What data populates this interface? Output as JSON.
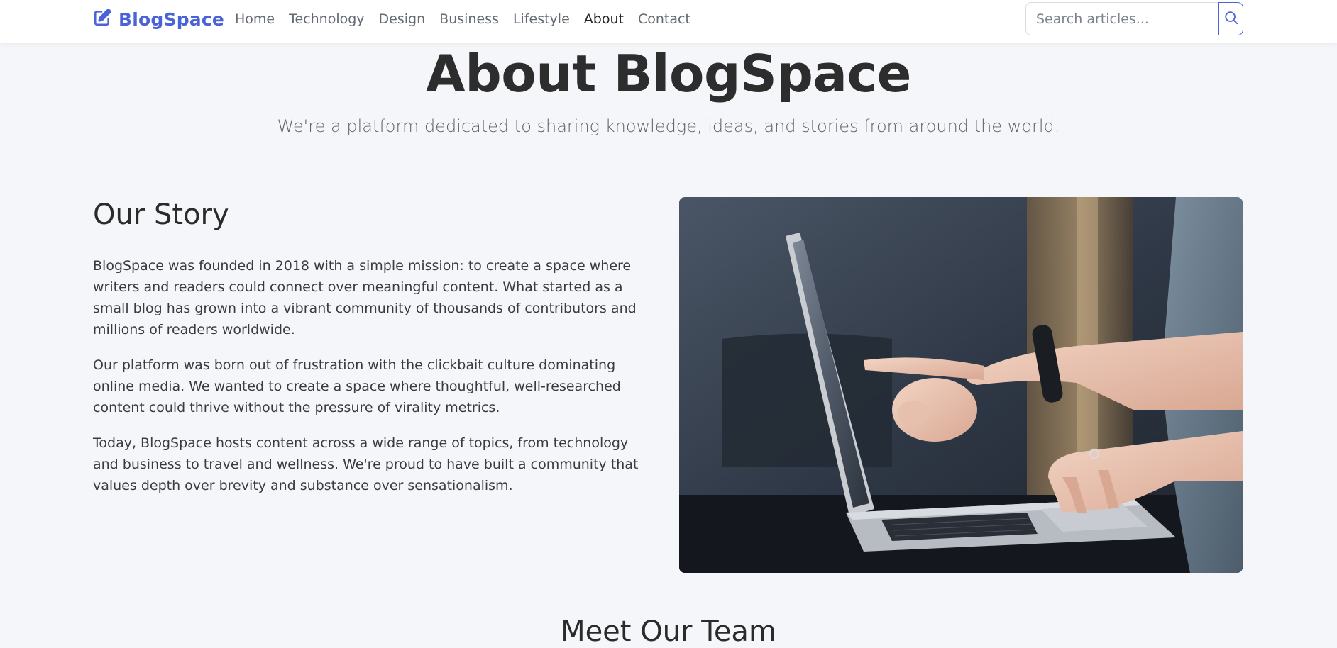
{
  "header": {
    "brand_name": "BlogSpace",
    "brand_icon": "pencil-square-icon",
    "nav_items": [
      {
        "label": "Home",
        "active": false
      },
      {
        "label": "Technology",
        "active": false
      },
      {
        "label": "Design",
        "active": false
      },
      {
        "label": "Business",
        "active": false
      },
      {
        "label": "Lifestyle",
        "active": false
      },
      {
        "label": "About",
        "active": true
      },
      {
        "label": "Contact",
        "active": false
      }
    ],
    "search": {
      "placeholder": "Search articles...",
      "value": "",
      "button_icon": "search-icon"
    }
  },
  "hero": {
    "title": "About BlogSpace",
    "subtitle": "We're a platform dedicated to sharing knowledge, ideas, and stories from around the world."
  },
  "story": {
    "heading": "Our Story",
    "paragraphs": [
      "BlogSpace was founded in 2018 with a simple mission: to create a space where writers and readers could connect over meaningful content. What started as a small blog has grown into a vibrant community of thousands of contributors and millions of readers worldwide.",
      "Our platform was born out of frustration with the clickbait culture dominating online media. We wanted to create a space where thoughtful, well-researched content could thrive without the pressure of virality metrics.",
      "Today, BlogSpace hosts content across a wide range of topics, from technology and business to travel and wellness. We're proud to have built a community that values depth over brevity and substance over sensationalism."
    ]
  },
  "team": {
    "heading": "Meet Our Team"
  },
  "colors": {
    "accent": "#4a63d8",
    "page_background": "#f5f6f9",
    "navbar_background": "#ffffff",
    "heading_text": "#2d2d2d",
    "muted_text": "#646a72"
  }
}
